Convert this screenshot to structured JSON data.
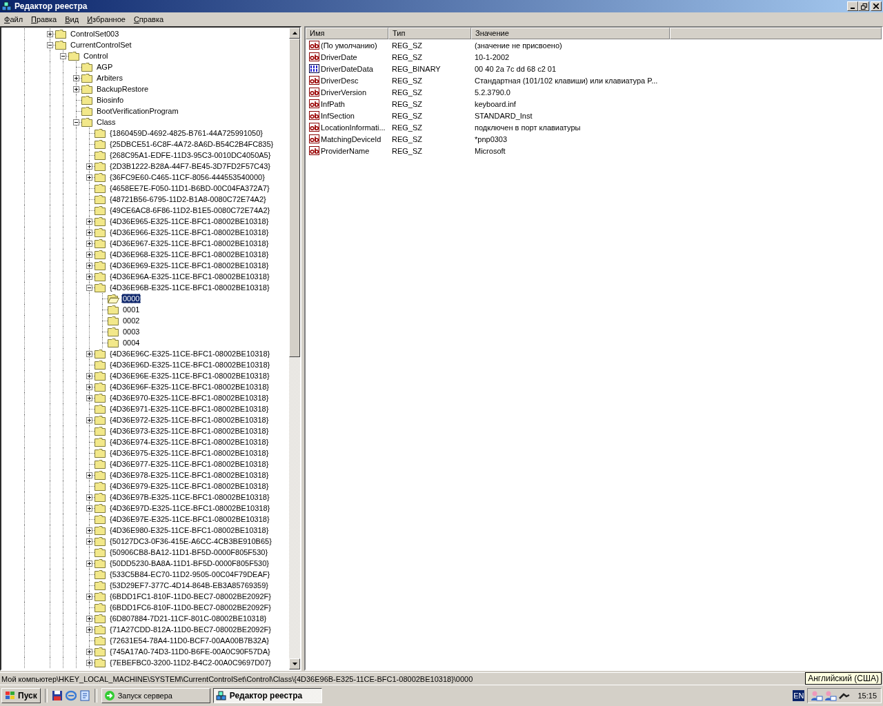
{
  "window": {
    "title": "Редактор реестра"
  },
  "menu": [
    "Файл",
    "Правка",
    "Вид",
    "Избранное",
    "Справка"
  ],
  "tree": [
    {
      "label": "ControlSet003",
      "expanded": false,
      "selected": false
    },
    {
      "label": "CurrentControlSet",
      "expanded": true,
      "selected": false,
      "children": [
        {
          "label": "Control",
          "expanded": true,
          "selected": false,
          "children": [
            {
              "label": "AGP",
              "selected": false
            },
            {
              "label": "Arbiters",
              "expanded": false,
              "selected": false
            },
            {
              "label": "BackupRestore",
              "expanded": false,
              "selected": false
            },
            {
              "label": "Biosinfo",
              "selected": false
            },
            {
              "label": "BootVerificationProgram",
              "selected": false
            },
            {
              "label": "Class",
              "expanded": true,
              "selected": false,
              "children": [
                {
                  "label": "{1860459D-4692-4825-B761-44A725991050}",
                  "selected": false
                },
                {
                  "label": "{25DBCE51-6C8F-4A72-8A6D-B54C2B4FC835}",
                  "selected": false
                },
                {
                  "label": "{268C95A1-EDFE-11D3-95C3-0010DC4050A5}",
                  "selected": false
                },
                {
                  "label": "{2D3B1222-B28A-44F7-BE45-3D7FD2F57C43}",
                  "expanded": false,
                  "selected": false
                },
                {
                  "label": "{36FC9E60-C465-11CF-8056-444553540000}",
                  "expanded": false,
                  "selected": false
                },
                {
                  "label": "{4658EE7E-F050-11D1-B6BD-00C04FA372A7}",
                  "selected": false
                },
                {
                  "label": "{48721B56-6795-11D2-B1A8-0080C72E74A2}",
                  "selected": false
                },
                {
                  "label": "{49CE6AC8-6F86-11D2-B1E5-0080C72E74A2}",
                  "selected": false
                },
                {
                  "label": "{4D36E965-E325-11CE-BFC1-08002BE10318}",
                  "expanded": false,
                  "selected": false
                },
                {
                  "label": "{4D36E966-E325-11CE-BFC1-08002BE10318}",
                  "expanded": false,
                  "selected": false
                },
                {
                  "label": "{4D36E967-E325-11CE-BFC1-08002BE10318}",
                  "expanded": false,
                  "selected": false
                },
                {
                  "label": "{4D36E968-E325-11CE-BFC1-08002BE10318}",
                  "expanded": false,
                  "selected": false
                },
                {
                  "label": "{4D36E969-E325-11CE-BFC1-08002BE10318}",
                  "expanded": false,
                  "selected": false
                },
                {
                  "label": "{4D36E96A-E325-11CE-BFC1-08002BE10318}",
                  "expanded": false,
                  "selected": false
                },
                {
                  "label": "{4D36E96B-E325-11CE-BFC1-08002BE10318}",
                  "expanded": true,
                  "selected": false,
                  "children": [
                    {
                      "label": "0000",
                      "selected": true
                    },
                    {
                      "label": "0001",
                      "selected": false
                    },
                    {
                      "label": "0002",
                      "selected": false
                    },
                    {
                      "label": "0003",
                      "selected": false
                    },
                    {
                      "label": "0004",
                      "selected": false
                    }
                  ]
                },
                {
                  "label": "{4D36E96C-E325-11CE-BFC1-08002BE10318}",
                  "expanded": false,
                  "selected": false
                },
                {
                  "label": "{4D36E96D-E325-11CE-BFC1-08002BE10318}",
                  "selected": false
                },
                {
                  "label": "{4D36E96E-E325-11CE-BFC1-08002BE10318}",
                  "expanded": false,
                  "selected": false
                },
                {
                  "label": "{4D36E96F-E325-11CE-BFC1-08002BE10318}",
                  "expanded": false,
                  "selected": false
                },
                {
                  "label": "{4D36E970-E325-11CE-BFC1-08002BE10318}",
                  "expanded": false,
                  "selected": false
                },
                {
                  "label": "{4D36E971-E325-11CE-BFC1-08002BE10318}",
                  "selected": false
                },
                {
                  "label": "{4D36E972-E325-11CE-BFC1-08002BE10318}",
                  "expanded": false,
                  "selected": false
                },
                {
                  "label": "{4D36E973-E325-11CE-BFC1-08002BE10318}",
                  "selected": false
                },
                {
                  "label": "{4D36E974-E325-11CE-BFC1-08002BE10318}",
                  "selected": false
                },
                {
                  "label": "{4D36E975-E325-11CE-BFC1-08002BE10318}",
                  "selected": false
                },
                {
                  "label": "{4D36E977-E325-11CE-BFC1-08002BE10318}",
                  "selected": false
                },
                {
                  "label": "{4D36E978-E325-11CE-BFC1-08002BE10318}",
                  "expanded": false,
                  "selected": false
                },
                {
                  "label": "{4D36E979-E325-11CE-BFC1-08002BE10318}",
                  "selected": false
                },
                {
                  "label": "{4D36E97B-E325-11CE-BFC1-08002BE10318}",
                  "expanded": false,
                  "selected": false
                },
                {
                  "label": "{4D36E97D-E325-11CE-BFC1-08002BE10318}",
                  "expanded": false,
                  "selected": false
                },
                {
                  "label": "{4D36E97E-E325-11CE-BFC1-08002BE10318}",
                  "selected": false
                },
                {
                  "label": "{4D36E980-E325-11CE-BFC1-08002BE10318}",
                  "expanded": false,
                  "selected": false
                },
                {
                  "label": "{50127DC3-0F36-415E-A6CC-4CB3BE910B65}",
                  "expanded": false,
                  "selected": false
                },
                {
                  "label": "{50906CB8-BA12-11D1-BF5D-0000F805F530}",
                  "selected": false
                },
                {
                  "label": "{50DD5230-BA8A-11D1-BF5D-0000F805F530}",
                  "expanded": false,
                  "selected": false
                },
                {
                  "label": "{533C5B84-EC70-11D2-9505-00C04F79DEAF}",
                  "selected": false
                },
                {
                  "label": "{53D29EF7-377C-4D14-864B-EB3A85769359}",
                  "selected": false
                },
                {
                  "label": "{6BDD1FC1-810F-11D0-BEC7-08002BE2092F}",
                  "expanded": false,
                  "selected": false
                },
                {
                  "label": "{6BDD1FC6-810F-11D0-BEC7-08002BE2092F}",
                  "selected": false
                },
                {
                  "label": "{6D807884-7D21-11CF-801C-08002BE10318}",
                  "expanded": false,
                  "selected": false
                },
                {
                  "label": "{71A27CDD-812A-11D0-BEC7-08002BE2092F}",
                  "expanded": false,
                  "selected": false
                },
                {
                  "label": "{72631E54-78A4-11D0-BCF7-00AA00B7B32A}",
                  "selected": false
                },
                {
                  "label": "{745A17A0-74D3-11D0-B6FE-00A0C90F57DA}",
                  "expanded": false,
                  "selected": false
                },
                {
                  "label": "{7EBEFBC0-3200-11D2-B4C2-00A0C9697D07}",
                  "expanded": false,
                  "selected": false
                }
              ]
            }
          ]
        }
      ]
    }
  ],
  "values": {
    "columns": [
      "Имя",
      "Тип",
      "Значение"
    ],
    "rows": [
      {
        "kind": "string",
        "name": "(По умолчанию)",
        "type": "REG_SZ",
        "data": "(значение не присвоено)"
      },
      {
        "kind": "string",
        "name": "DriverDate",
        "type": "REG_SZ",
        "data": "10-1-2002"
      },
      {
        "kind": "binary",
        "name": "DriverDateData",
        "type": "REG_BINARY",
        "data": "00 40 2a 7c dd 68 c2 01"
      },
      {
        "kind": "string",
        "name": "DriverDesc",
        "type": "REG_SZ",
        "data": "Стандартная (101/102 клавиши) или клавиатура P..."
      },
      {
        "kind": "string",
        "name": "DriverVersion",
        "type": "REG_SZ",
        "data": "5.2.3790.0"
      },
      {
        "kind": "string",
        "name": "InfPath",
        "type": "REG_SZ",
        "data": "keyboard.inf"
      },
      {
        "kind": "string",
        "name": "InfSection",
        "type": "REG_SZ",
        "data": "STANDARD_Inst"
      },
      {
        "kind": "string",
        "name": "LocationInformati...",
        "type": "REG_SZ",
        "data": "подключен в порт клавиатуры"
      },
      {
        "kind": "string",
        "name": "MatchingDeviceId",
        "type": "REG_SZ",
        "data": "*pnp0303"
      },
      {
        "kind": "string",
        "name": "ProviderName",
        "type": "REG_SZ",
        "data": "Microsoft"
      }
    ]
  },
  "status_bar": "Мой компьютер\\HKEY_LOCAL_MACHINE\\SYSTEM\\CurrentControlSet\\Control\\Class\\{4D36E96B-E325-11CE-BFC1-08002BE10318}\\0000",
  "tooltip": "Английский (США)",
  "taskbar": {
    "start": "Пуск",
    "tasks": [
      {
        "kind": "server",
        "label": "Запуск сервера",
        "selected": false
      },
      {
        "kind": "registry",
        "label": "Редактор реестра",
        "selected": true
      }
    ],
    "language": "EN",
    "clock": "15:15"
  }
}
